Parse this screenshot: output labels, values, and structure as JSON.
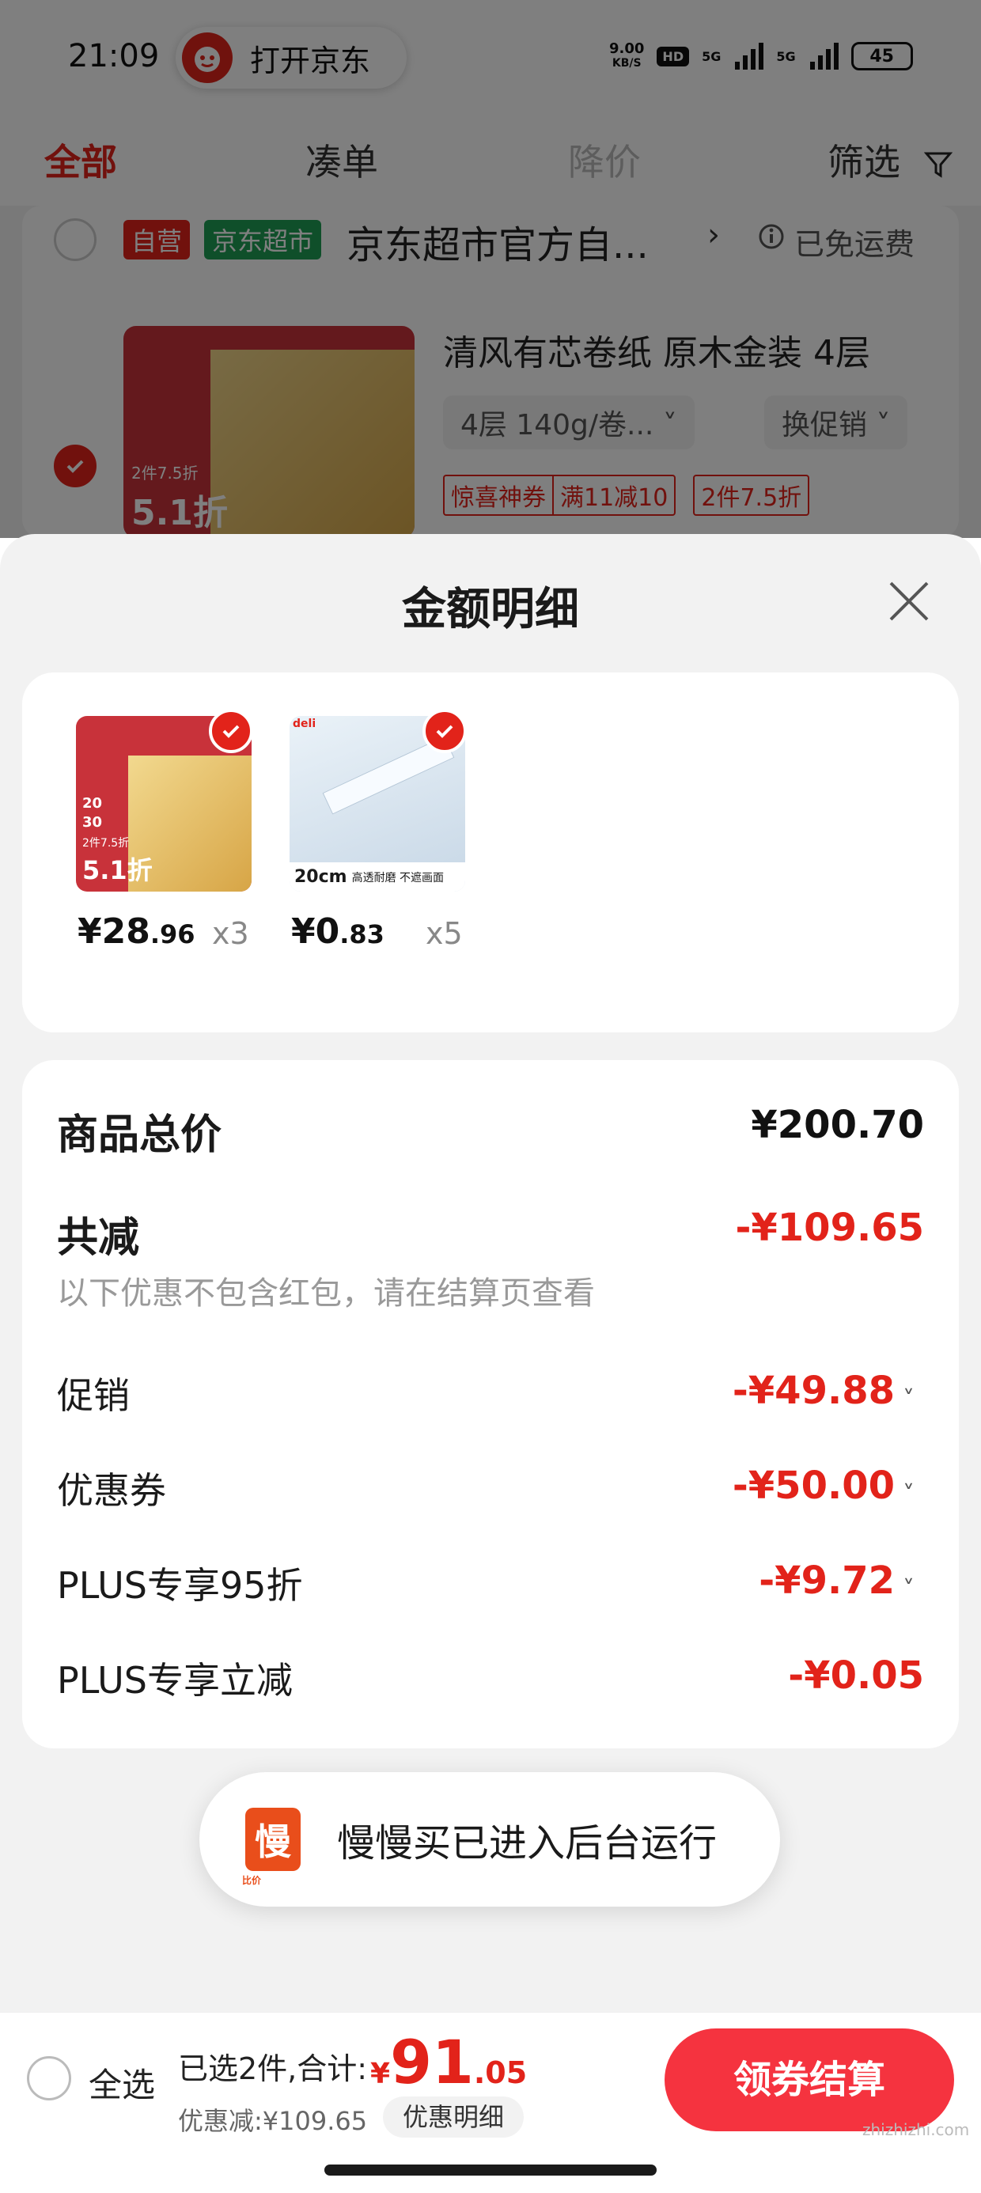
{
  "status_bar": {
    "time": "21:09",
    "open_app_label": "打开京东",
    "net_speed_value": "9.00",
    "net_speed_unit": "KB/S",
    "hd_label": "HD",
    "net1": "5G",
    "net2": "5G",
    "battery": "45"
  },
  "tabs": [
    {
      "label": "全部",
      "active": true
    },
    {
      "label": "凑单",
      "active": false
    },
    {
      "label": "降价",
      "active": false
    },
    {
      "label": "筛选",
      "active": false
    }
  ],
  "background_cart": {
    "tag_self": "自营",
    "tag_market": "京东超市",
    "shop_name": "京东超市官方自...",
    "free_shipping": "已免运费",
    "product_title": "清风有芯卷纸 原木金装 4层",
    "spec": "4层 140g/卷...",
    "promo_select": "换促销",
    "coupon_tag1": "惊喜神券",
    "coupon_tag2": "满11减10",
    "coupon_tag3": "2件7.5折",
    "img_text1": "2件7.5折",
    "img_text2": "5.1折"
  },
  "sheet": {
    "title": "金额明细",
    "items": [
      {
        "price_int": "¥28",
        "price_dec": ".96",
        "qty": "x3",
        "img_text1": "2件7.5折",
        "img_text2": "5.1折",
        "img_text3": "20",
        "img_text4": "30"
      },
      {
        "price_int": "¥0",
        "price_dec": ".83",
        "qty": "x5",
        "img_text1": "20cm",
        "img_text2": "高透耐磨 不遮画面",
        "brand": "deli"
      }
    ],
    "summary": {
      "total_label": "商品总价",
      "total_value": "¥200.70",
      "reduce_label": "共减",
      "reduce_value": "-¥109.65",
      "note": "以下优惠不包含红包，请在结算页查看",
      "rows": [
        {
          "label": "促销",
          "value": "-¥49.88",
          "expand": true
        },
        {
          "label": "优惠券",
          "value": "-¥50.00",
          "expand": true
        },
        {
          "label": "PLUS专享95折",
          "value": "-¥9.72",
          "expand": true
        },
        {
          "label": "PLUS专享立减",
          "value": "-¥0.05",
          "expand": false
        }
      ]
    },
    "toast": {
      "icon_char": "慢",
      "icon_caption": "比价",
      "text": "慢慢买已进入后台运行"
    }
  },
  "bottom_bar": {
    "select_all": "全选",
    "selected_text": "已选2件,合计:",
    "total_currency": "¥",
    "total_int": "91",
    "total_dec": ".05",
    "discount_text": "优惠减:¥109.65",
    "detail_button": "优惠明细",
    "checkout_button": "领券结算"
  },
  "watermark": "zhizhizhi.com",
  "colors": {
    "accent": "#e2231a",
    "checkout": "#f5333f",
    "sheet_bg": "#f2f2f2"
  }
}
